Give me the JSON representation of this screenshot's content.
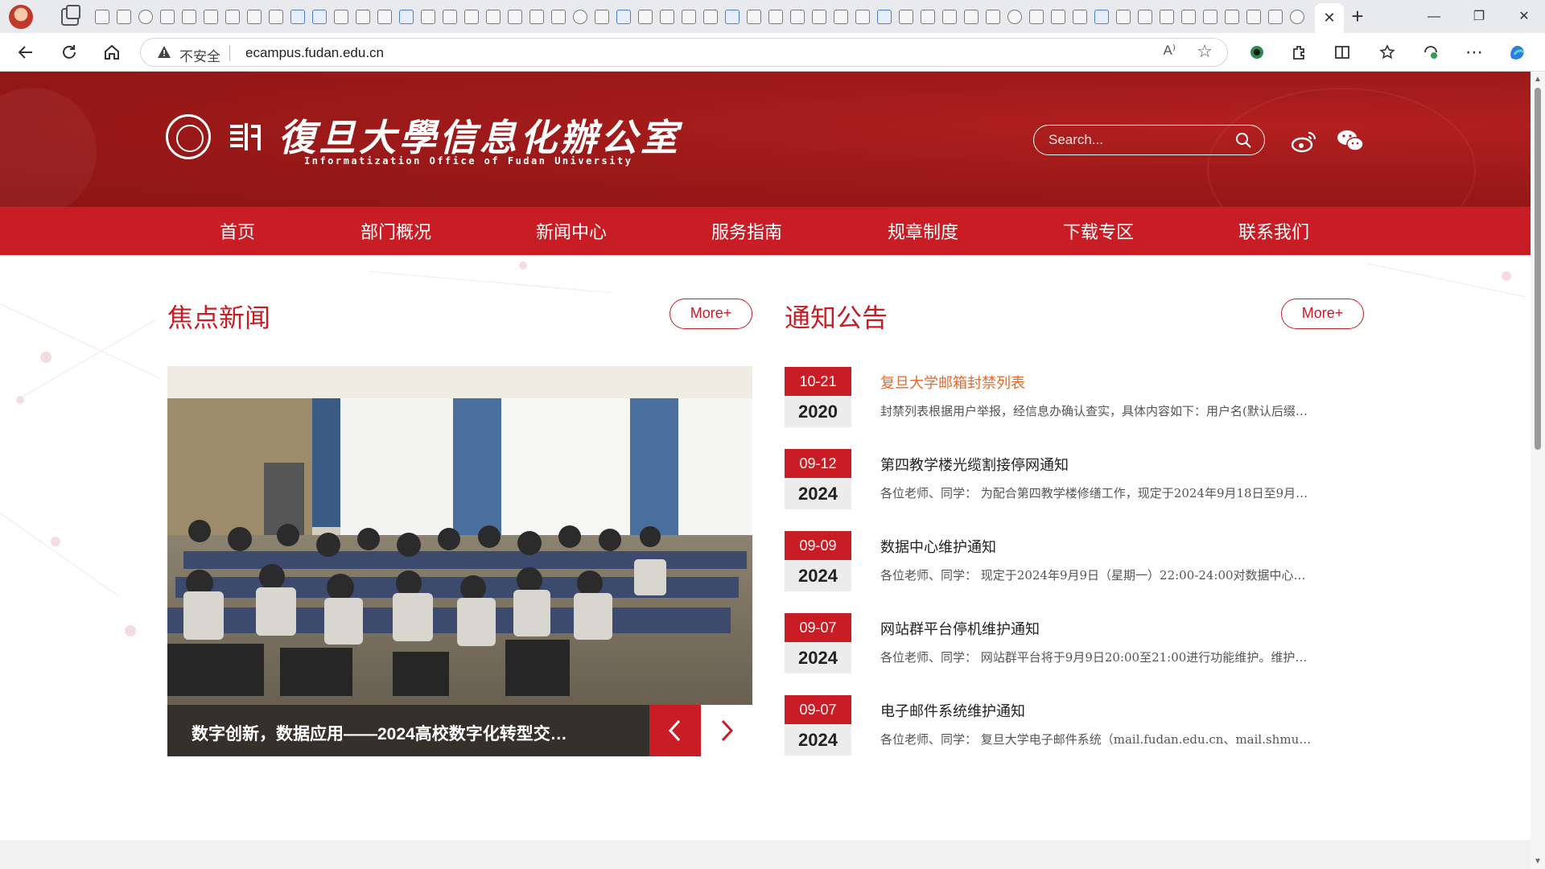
{
  "browser": {
    "active_tab_close": "✕",
    "new_tab": "+",
    "window_controls": {
      "minimize": "—",
      "restore": "❐",
      "close": "✕"
    },
    "security_label": "不安全",
    "url": "ecampus.fudan.edu.cn",
    "read_aloud_label": "A⁾",
    "toolbar_icons": [
      "back-icon",
      "reload-icon",
      "home-icon",
      "extension-icon",
      "split-screen-icon",
      "favorites-icon",
      "browser-essentials-icon",
      "more-icon",
      "copilot-icon"
    ]
  },
  "header": {
    "title_cn": "復旦大學信息化辦公室",
    "title_en": "Informatization Office of Fudan University",
    "search_placeholder": "Search...",
    "accent_color": "#c81d25"
  },
  "nav": {
    "items": [
      "首页",
      "部门概况",
      "新闻中心",
      "服务指南",
      "规章制度",
      "下载专区",
      "联系我们"
    ]
  },
  "focus_news": {
    "title": "焦点新闻",
    "more": "More+",
    "caption": "数字创新，数据应用——2024高校数字化转型交…",
    "prev": "‹",
    "next": "›"
  },
  "notices": {
    "title": "通知公告",
    "more": "More+",
    "items": [
      {
        "date": "10-21",
        "year": "2020",
        "title": "复旦大学邮箱封禁列表",
        "desc": "封禁列表根据用户举报，经信息办确认查实，具体内容如下：用户名(默认后缀…",
        "highlight": true
      },
      {
        "date": "09-12",
        "year": "2024",
        "title": "第四教学楼光缆割接停网通知",
        "desc": "各位老师、同学： 为配合第四教学楼修缮工作，现定于2024年9月18日至9月…",
        "highlight": false
      },
      {
        "date": "09-09",
        "year": "2024",
        "title": "数据中心维护通知",
        "desc": "各位老师、同学： 现定于2024年9月9日（星期一）22:00-24:00对数据中心…",
        "highlight": false
      },
      {
        "date": "09-07",
        "year": "2024",
        "title": "网站群平台停机维护通知",
        "desc": "各位老师、同学： 网站群平台将于9月9日20:00至21:00进行功能维护。维护…",
        "highlight": false
      },
      {
        "date": "09-07",
        "year": "2024",
        "title": "电子邮件系统维护通知",
        "desc": "各位老师、同学： 复旦大学电子邮件系统（mail.fudan.edu.cn、mail.shmu…",
        "highlight": false
      }
    ]
  }
}
